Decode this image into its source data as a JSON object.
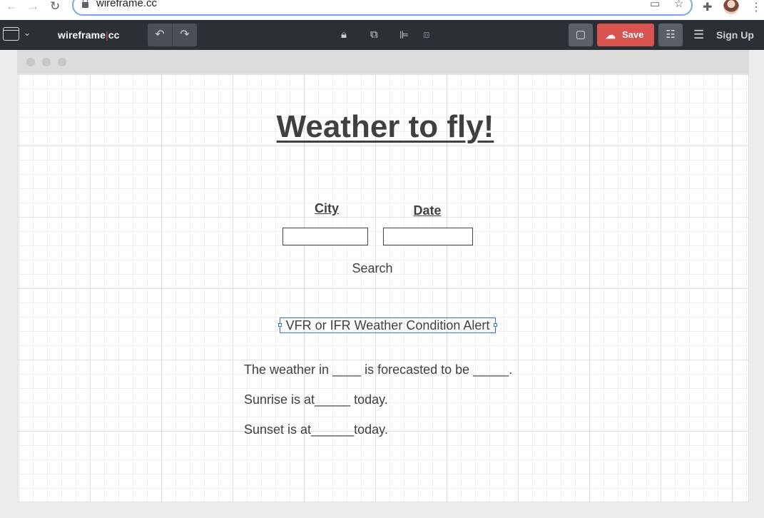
{
  "browser": {
    "url": "wireframe.cc"
  },
  "toolbar": {
    "brand_left": "wireframe",
    "brand_sep": "|",
    "brand_right": "cc",
    "save_label": "Save",
    "signup_label": "Sign Up"
  },
  "wireframe": {
    "title": "Weather to fly!",
    "city_label": "City",
    "date_label": "Date",
    "city_value": "",
    "date_value": "",
    "search_label": "Search",
    "alert_text": "VFR or IFR Weather Condition Alert",
    "line1": "The weather in ____ is forecasted to be _____.",
    "line2": "Sunrise is at_____ today.",
    "line3": "Sunset is at______today."
  },
  "colors": {
    "toolbar_bg": "#2b2f36",
    "save_button": "#d9534f",
    "selection": "#3a78c4",
    "text": "#404040"
  }
}
